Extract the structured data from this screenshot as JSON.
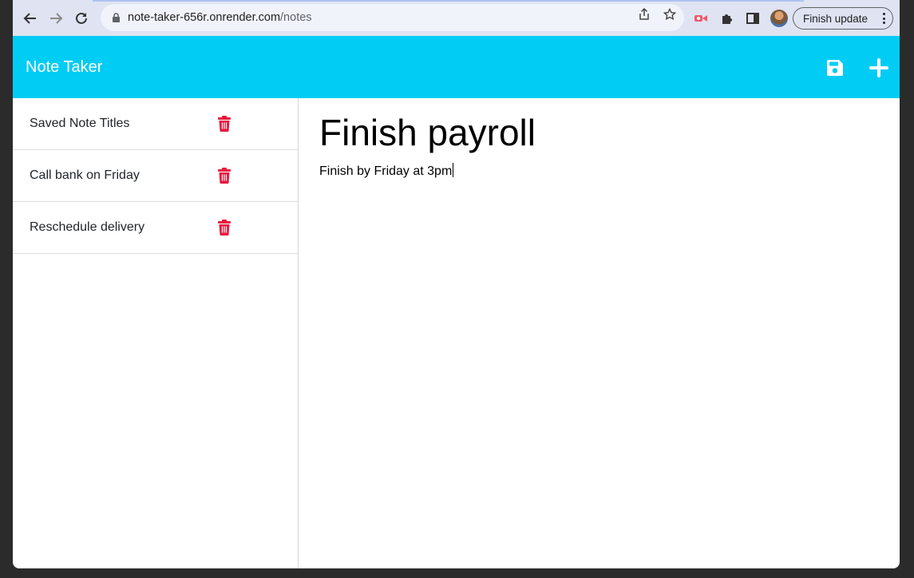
{
  "browser": {
    "url_host": "note-taker-656r.onrender.com",
    "url_path": "/notes",
    "update_button_label": "Finish update"
  },
  "app": {
    "title": "Note Taker",
    "accent_color": "#00ccf4",
    "actions": [
      {
        "icon": "save-icon"
      },
      {
        "icon": "plus-icon"
      }
    ]
  },
  "sidebar": {
    "notes": [
      {
        "label": "Saved Note Titles"
      },
      {
        "label": "Call bank on Friday"
      },
      {
        "label": "Reschedule delivery"
      }
    ],
    "delete_icon_color": "#e8183e"
  },
  "editor": {
    "title": "Finish payroll",
    "body": "Finish by Friday at 3pm"
  }
}
